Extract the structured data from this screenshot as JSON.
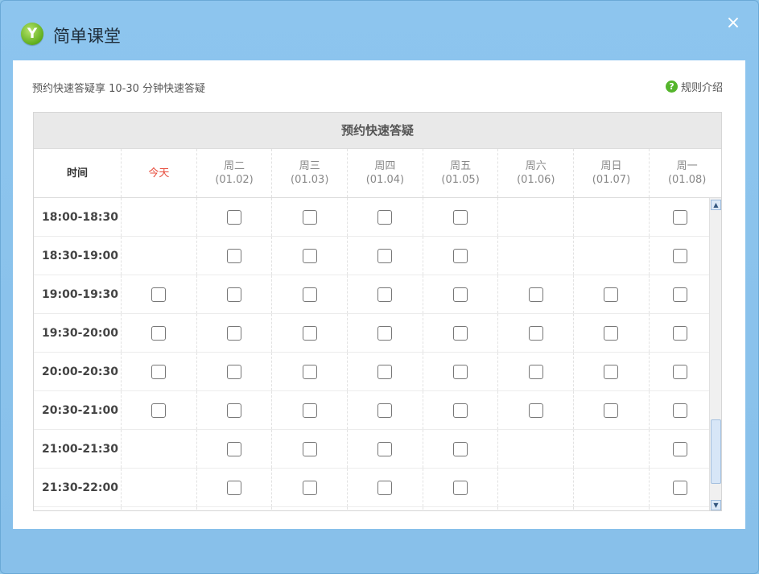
{
  "window": {
    "title": "简单课堂",
    "logo_letter": "Y",
    "close_label": "×"
  },
  "intro_text": "预约快速答疑享 10-30 分钟快速答疑",
  "rules_label": "规则介绍",
  "rules_icon_label": "?",
  "table": {
    "caption": "预约快速答疑",
    "time_header": "时间",
    "days": [
      {
        "name": "今天",
        "date": ""
      },
      {
        "name": "周二",
        "date": "(01.02)"
      },
      {
        "name": "周三",
        "date": "(01.03)"
      },
      {
        "name": "周四",
        "date": "(01.04)"
      },
      {
        "name": "周五",
        "date": "(01.05)"
      },
      {
        "name": "周六",
        "date": "(01.06)"
      },
      {
        "name": "周日",
        "date": "(01.07)"
      },
      {
        "name": "周一",
        "date": "(01.08)"
      }
    ],
    "slots": [
      {
        "time": "18:00-18:30",
        "available": [
          false,
          true,
          true,
          true,
          true,
          false,
          false,
          true
        ]
      },
      {
        "time": "18:30-19:00",
        "available": [
          false,
          true,
          true,
          true,
          true,
          false,
          false,
          true
        ]
      },
      {
        "time": "19:00-19:30",
        "available": [
          true,
          true,
          true,
          true,
          true,
          true,
          true,
          true
        ]
      },
      {
        "time": "19:30-20:00",
        "available": [
          true,
          true,
          true,
          true,
          true,
          true,
          true,
          true
        ]
      },
      {
        "time": "20:00-20:30",
        "available": [
          true,
          true,
          true,
          true,
          true,
          true,
          true,
          true
        ]
      },
      {
        "time": "20:30-21:00",
        "available": [
          true,
          true,
          true,
          true,
          true,
          true,
          true,
          true
        ]
      },
      {
        "time": "21:00-21:30",
        "available": [
          false,
          true,
          true,
          true,
          true,
          false,
          false,
          true
        ]
      },
      {
        "time": "21:30-22:00",
        "available": [
          false,
          true,
          true,
          true,
          true,
          false,
          false,
          true
        ]
      },
      {
        "time": "",
        "available": [
          false,
          false,
          false,
          false,
          false,
          false,
          false,
          false
        ]
      }
    ]
  },
  "scrollbar": {
    "up_icon": "▲",
    "down_icon": "▼"
  },
  "colors": {
    "frame": "#8ec6ea",
    "today": "#e74c3c",
    "rules_icon": "#55b52c"
  }
}
